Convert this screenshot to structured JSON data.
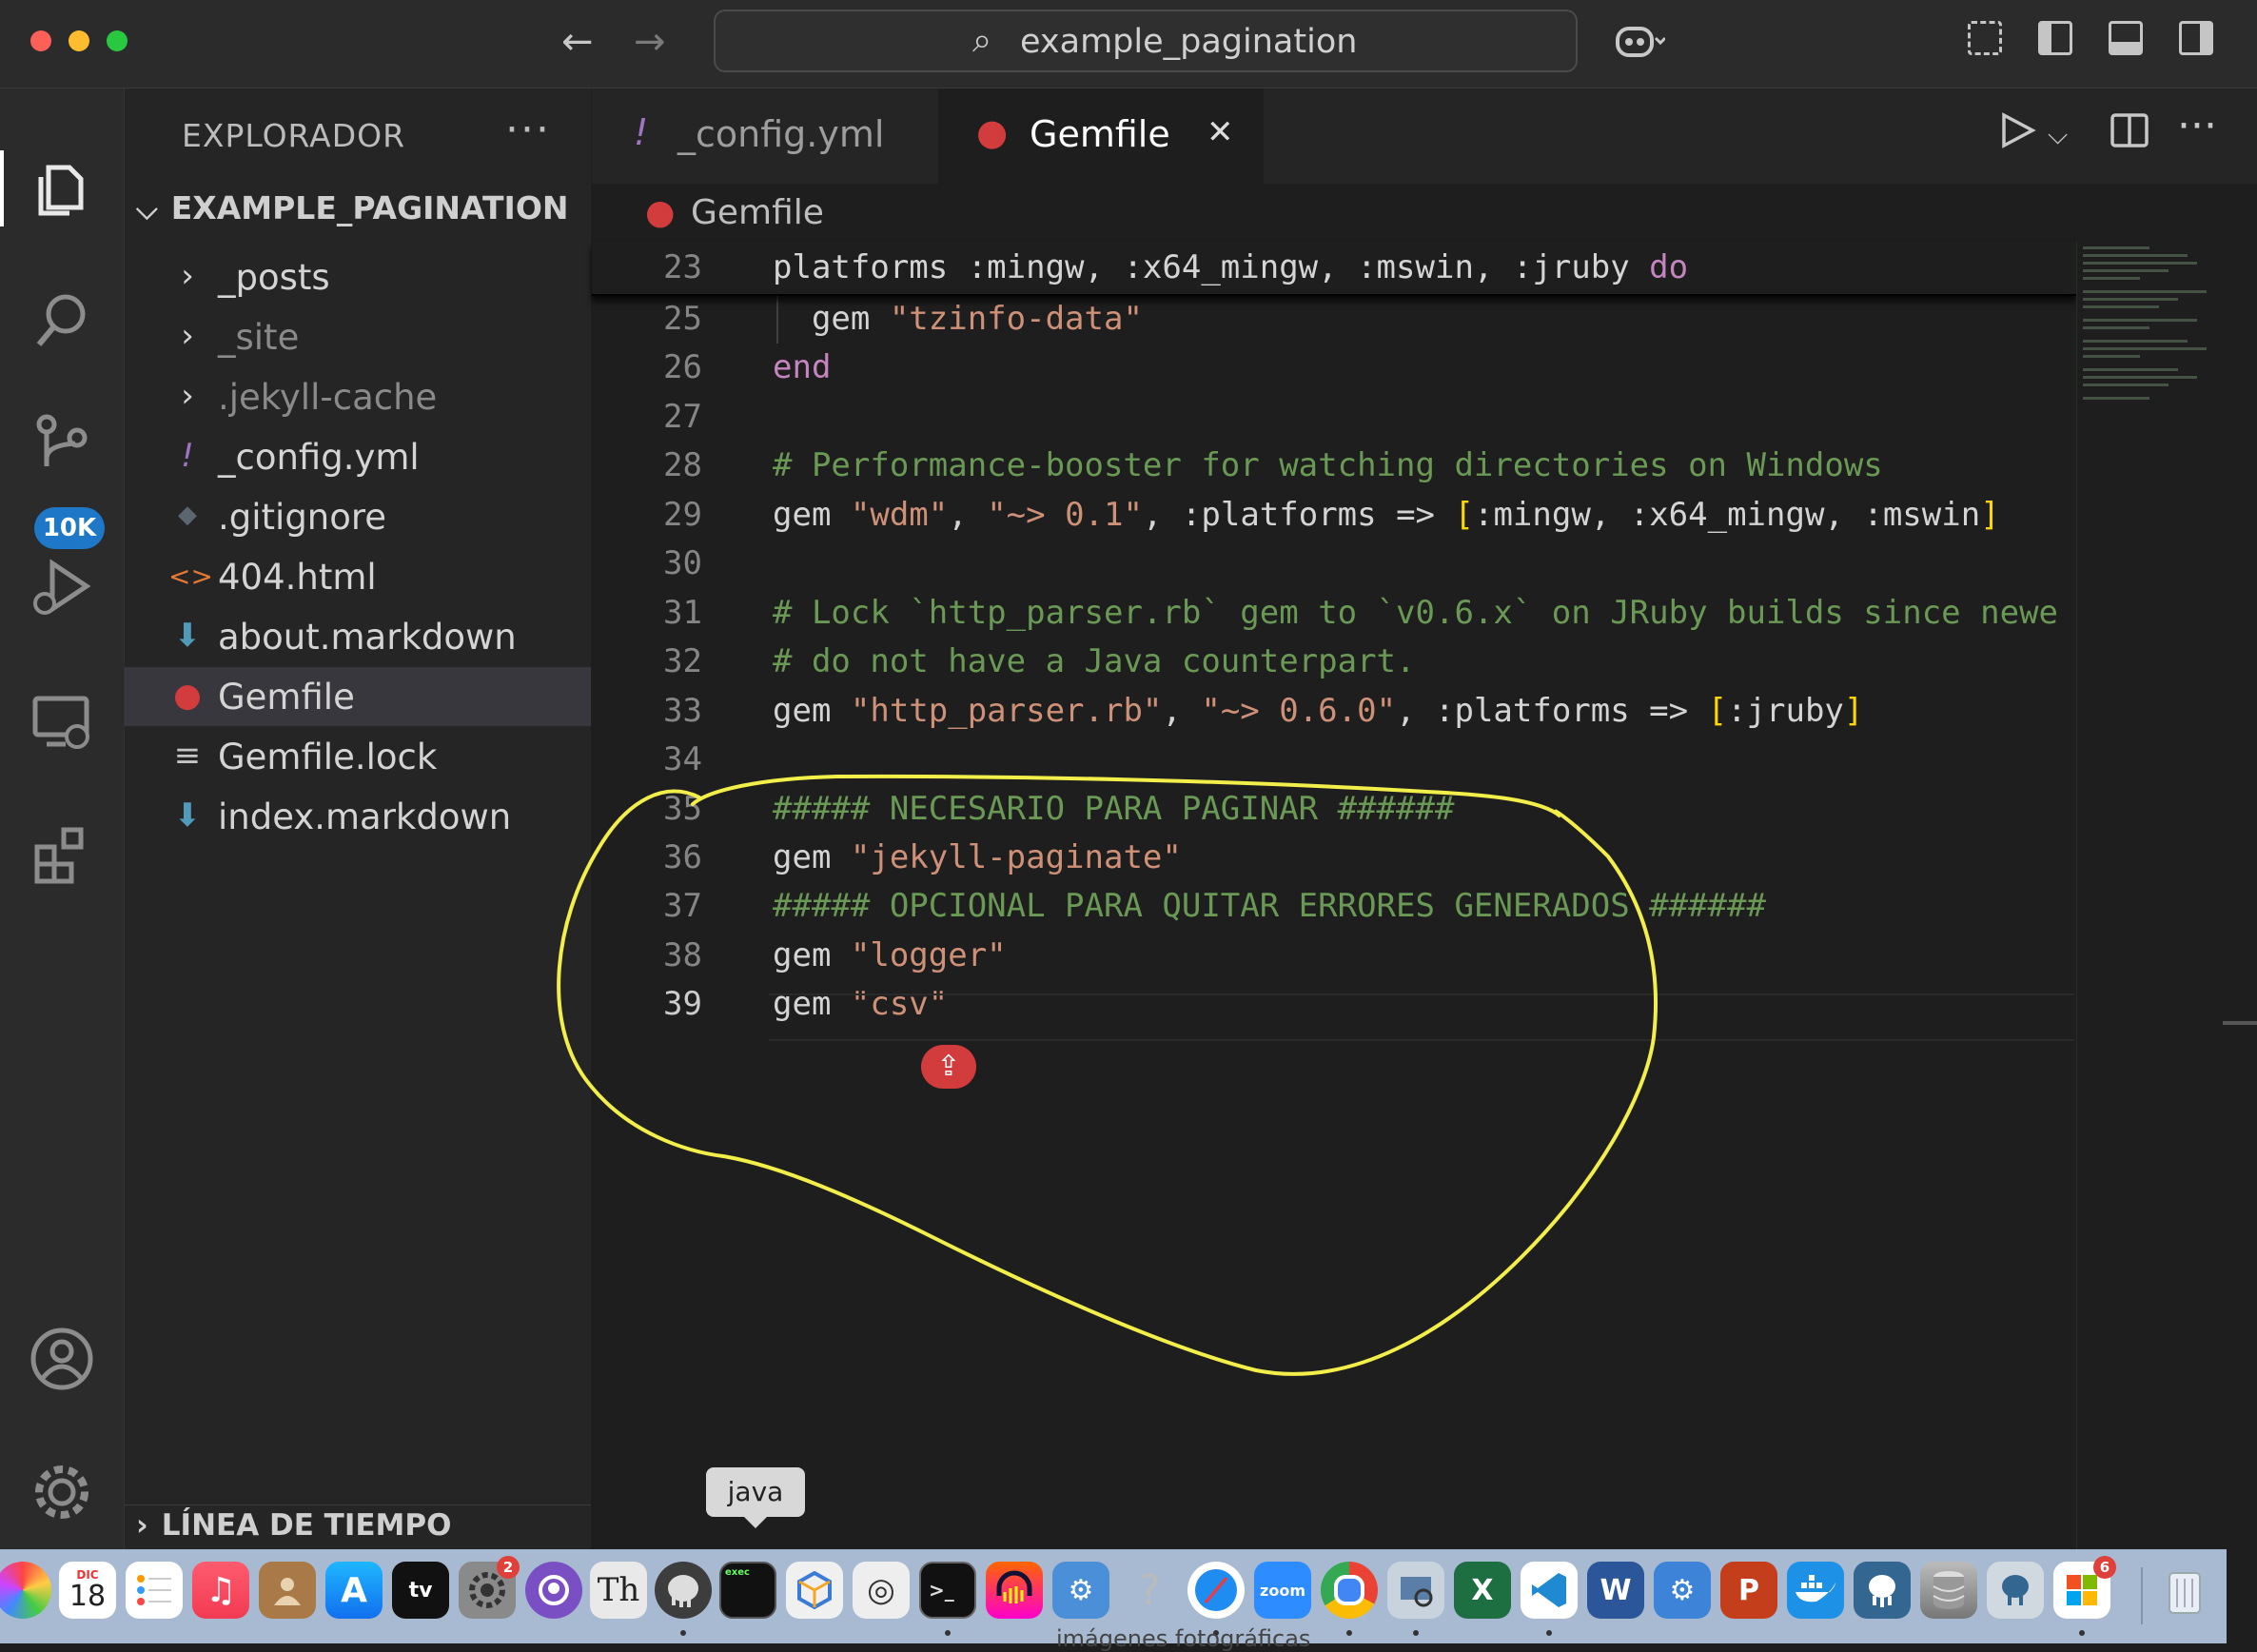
{
  "window": {
    "search_text": "example_pagination"
  },
  "explorer": {
    "title": "EXPLORADOR",
    "more": "···",
    "folder": "EXAMPLE_PAGINATION",
    "items": [
      {
        "label": "_posts",
        "icon": "chevron-right",
        "kind": "folder"
      },
      {
        "label": "_site",
        "icon": "chevron-right",
        "kind": "folder"
      },
      {
        "label": ".jekyll-cache",
        "icon": "chevron-right",
        "kind": "folder"
      },
      {
        "label": "_config.yml",
        "icon": "!",
        "kind": "file"
      },
      {
        "label": ".gitignore",
        "icon": "◆",
        "kind": "file"
      },
      {
        "label": "404.html",
        "icon": "<>",
        "kind": "file"
      },
      {
        "label": "about.markdown",
        "icon": "⬇",
        "kind": "file"
      },
      {
        "label": "Gemfile",
        "icon": "●",
        "kind": "file"
      },
      {
        "label": "Gemfile.lock",
        "icon": "≡",
        "kind": "file"
      },
      {
        "label": "index.markdown",
        "icon": "⬇",
        "kind": "file"
      }
    ],
    "timeline": "LÍNEA DE TIEMPO"
  },
  "activity": {
    "source_control_badge": "10K"
  },
  "tabs": [
    {
      "label": "_config.yml",
      "icon": "!"
    },
    {
      "label": "Gemfile",
      "icon": "●",
      "close": "✕"
    }
  ],
  "breadcrumb": "Gemfile",
  "sticky": {
    "num": "23",
    "code": "platforms :mingw, :x64_mingw, :mswin, :jruby "
  },
  "sticky_kw": "do",
  "code_lines": [
    {
      "num": "25",
      "parts": [
        {
          "t": "  gem ",
          "c": ""
        },
        {
          "t": "\"tzinfo-data\"",
          "c": "str"
        }
      ]
    },
    {
      "num": "26",
      "parts": [
        {
          "t": "end",
          "c": "kw"
        }
      ]
    },
    {
      "num": "27",
      "parts": []
    },
    {
      "num": "28",
      "parts": [
        {
          "t": "# Performance-booster for watching directories on Windows",
          "c": "cmt"
        }
      ]
    },
    {
      "num": "29",
      "parts": [
        {
          "t": "gem ",
          "c": ""
        },
        {
          "t": "\"wdm\"",
          "c": "str"
        },
        {
          "t": ", ",
          "c": ""
        },
        {
          "t": "\"~> 0.1\"",
          "c": "str"
        },
        {
          "t": ", :platforms => ",
          "c": ""
        },
        {
          "t": "[",
          "c": "br"
        },
        {
          "t": ":mingw, :x64_mingw, :mswin",
          "c": ""
        },
        {
          "t": "]",
          "c": "br"
        }
      ]
    },
    {
      "num": "30",
      "parts": []
    },
    {
      "num": "31",
      "parts": [
        {
          "t": "# Lock `http_parser.rb` gem to `v0.6.x` on JRuby builds since newe",
          "c": "cmt"
        }
      ]
    },
    {
      "num": "32",
      "parts": [
        {
          "t": "# do not have a Java counterpart.",
          "c": "cmt"
        }
      ]
    },
    {
      "num": "33",
      "parts": [
        {
          "t": "gem ",
          "c": ""
        },
        {
          "t": "\"http_parser.rb\"",
          "c": "str"
        },
        {
          "t": ", ",
          "c": ""
        },
        {
          "t": "\"~> 0.6.0\"",
          "c": "str"
        },
        {
          "t": ", :platforms => ",
          "c": ""
        },
        {
          "t": "[",
          "c": "br"
        },
        {
          "t": ":jruby",
          "c": ""
        },
        {
          "t": "]",
          "c": "br"
        }
      ]
    },
    {
      "num": "34",
      "parts": []
    },
    {
      "num": "35",
      "parts": [
        {
          "t": "##### NECESARIO PARA PAGINAR ######",
          "c": "cmt"
        }
      ]
    },
    {
      "num": "36",
      "parts": [
        {
          "t": "gem ",
          "c": ""
        },
        {
          "t": "\"jekyll-paginate\"",
          "c": "str"
        }
      ]
    },
    {
      "num": "37",
      "parts": [
        {
          "t": "##### OPCIONAL PARA QUITAR ERRORES GENERADOS ######",
          "c": "cmt"
        }
      ]
    },
    {
      "num": "38",
      "parts": [
        {
          "t": "gem ",
          "c": ""
        },
        {
          "t": "\"logger\"",
          "c": "str"
        }
      ]
    },
    {
      "num": "39",
      "parts": [
        {
          "t": "gem ",
          "c": ""
        },
        {
          "t": "\"csv\"",
          "c": "str"
        }
      ]
    }
  ],
  "tooltip": "java",
  "dock": {
    "calendar_month": "DIC",
    "calendar_day": "18",
    "appletv": "tv",
    "zoom": "zoom",
    "settings_badge": "2",
    "store_badge": "6",
    "exec_label": "exec"
  },
  "behind_text": "imágenes fotográficas",
  "colors": {
    "accent": "#1e78c7",
    "annotation": "#f2ee4a",
    "ruby_red": "#d33c3c"
  }
}
